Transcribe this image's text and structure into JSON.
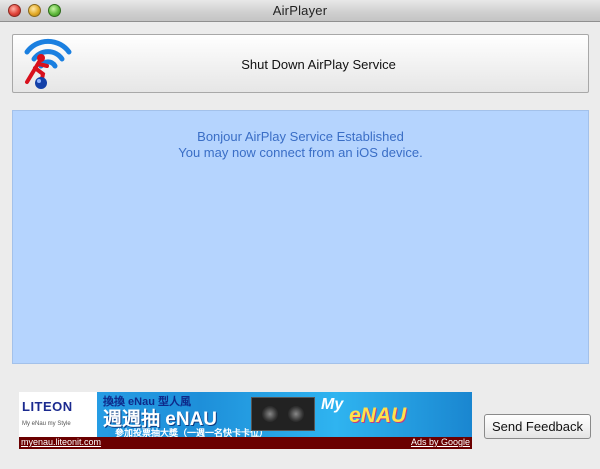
{
  "window": {
    "title": "AirPlayer",
    "controls": [
      "close",
      "minimize",
      "zoom"
    ]
  },
  "shutdown": {
    "label": "Shut Down AirPlay Service",
    "logo_icon": "airplay-wifi-runner-icon"
  },
  "status": {
    "line1": "Bonjour AirPlay Service Established",
    "line2": "You may now connect from an iOS device."
  },
  "ad": {
    "brand": "LITEON",
    "brand_tagline": "My eNau my Style",
    "headline_top": "換換 eNau 型人風",
    "headline": "週週抽 eNAU",
    "headline_sub": "參加投票抽大獎（一週一名快卡卡位）",
    "slogan_small": "My",
    "slogan": "eNAU",
    "url": "myenau.liteonit.com",
    "ads_by": "Ads by Google"
  },
  "feedback": {
    "label": "Send Feedback"
  },
  "colors": {
    "status_bg": "#b5d4fe",
    "status_text": "#3a6ec6",
    "window_bg": "#ececec"
  }
}
